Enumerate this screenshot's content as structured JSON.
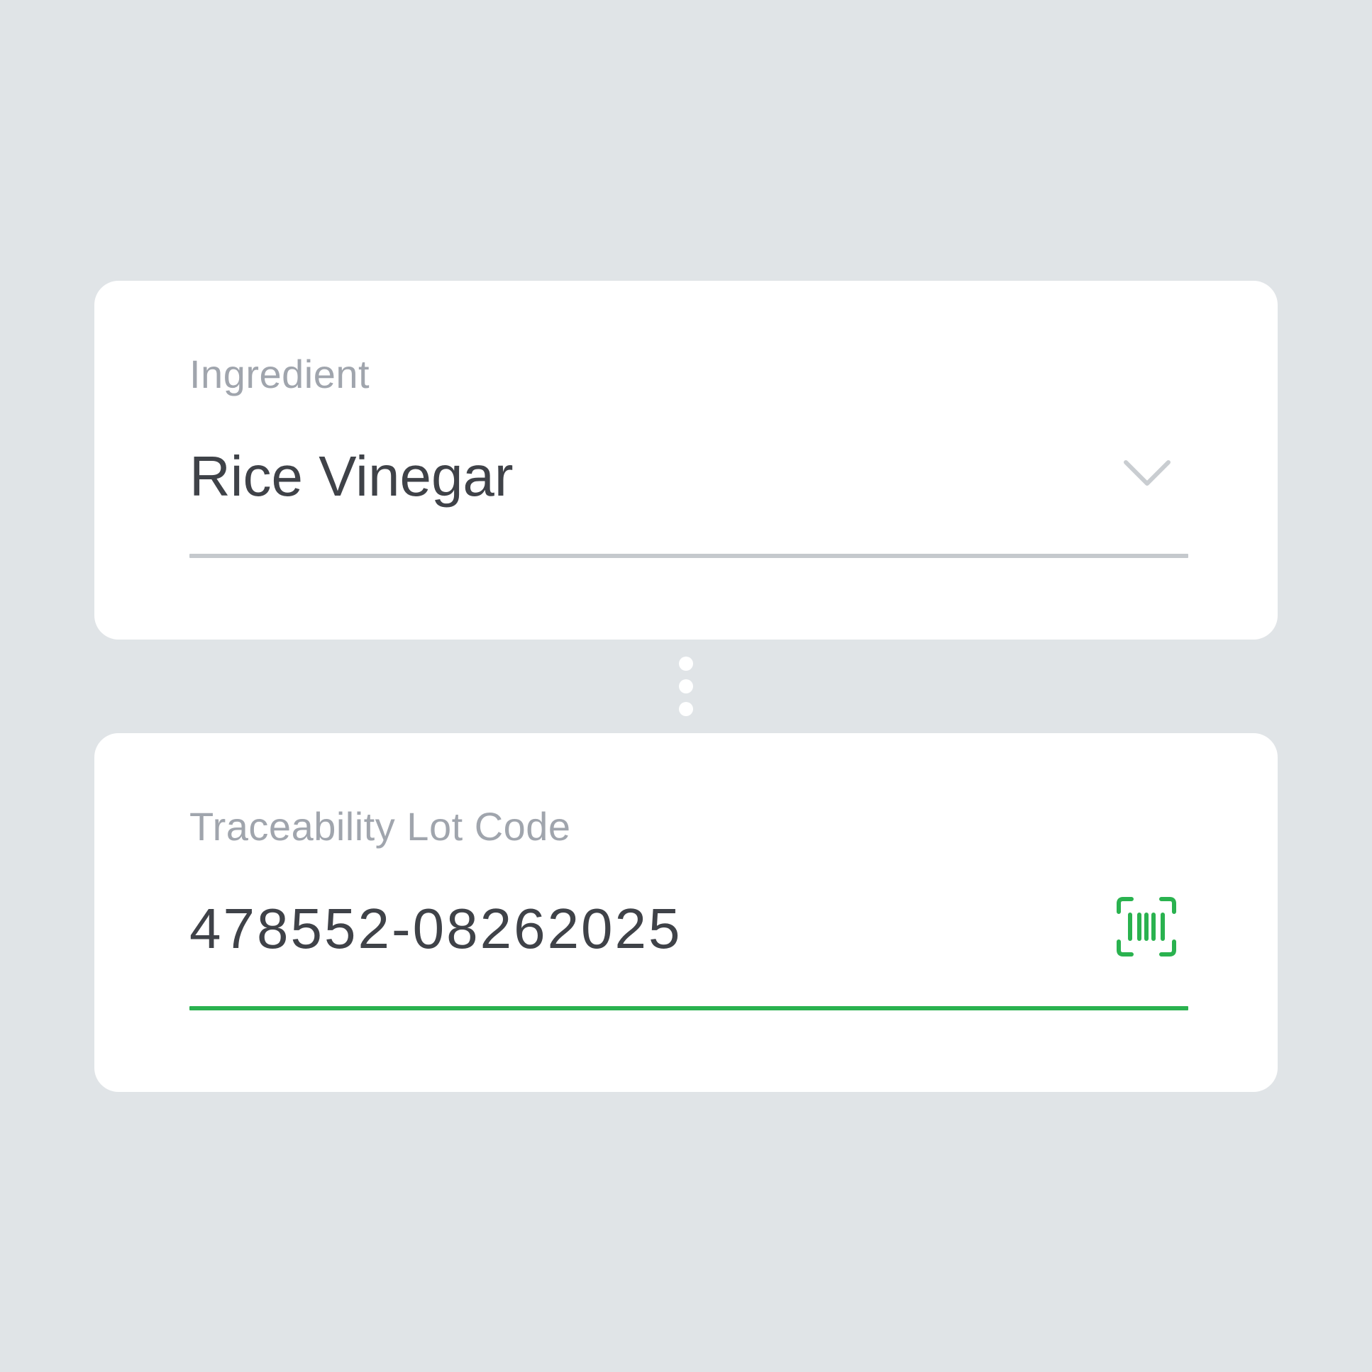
{
  "colors": {
    "background": "#e0e4e7",
    "card": "#ffffff",
    "label": "#a0a5ad",
    "value": "#3f4248",
    "underline_inactive": "#c5c9cd",
    "accent_green": "#2ab24f",
    "chevron": "#c9cdd1"
  },
  "ingredient_field": {
    "label": "Ingredient",
    "value": "Rice Vinegar",
    "icon": "chevron-down-icon"
  },
  "lot_code_field": {
    "label": "Traceability Lot Code",
    "value": "478552-08262025",
    "icon": "barcode-scan-icon"
  }
}
